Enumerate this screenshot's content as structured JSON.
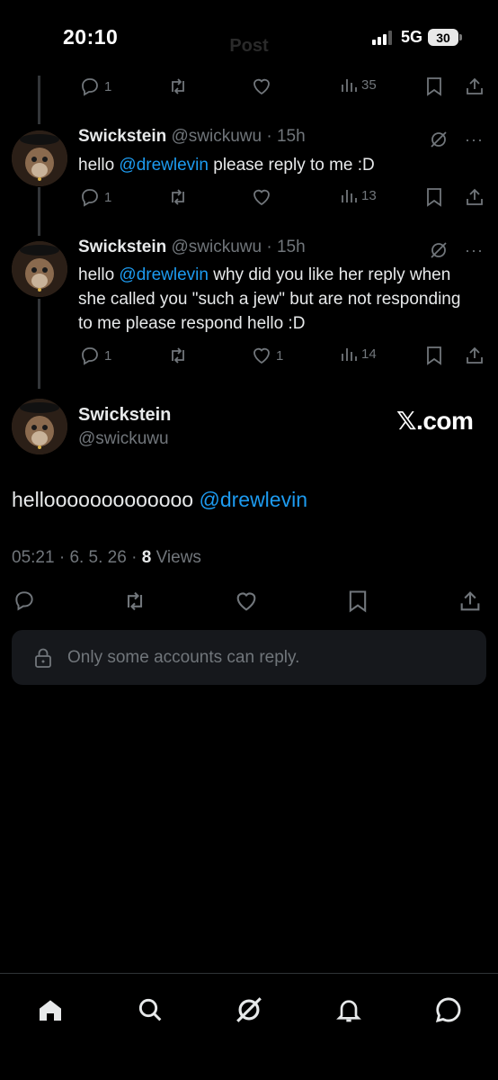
{
  "status_bar": {
    "time": "20:10",
    "network": "5G",
    "battery": "30",
    "faded_title": "Post"
  },
  "previous_post_actions": {
    "replies": "1",
    "views": "35"
  },
  "replies": [
    {
      "name": "Swickstein",
      "handle": "@swickuwu",
      "time": "15h",
      "text_before": "hello ",
      "mention": "@drewlevin",
      "text_after": " please reply to me :D",
      "reply_count": "1",
      "like_count": "",
      "view_count": "13"
    },
    {
      "name": "Swickstein",
      "handle": "@swickuwu",
      "time": "15h",
      "text_before": "hello ",
      "mention": "@drewlevin",
      "text_after": " why did you like her reply when she called you \"such a jew\" but are not responding to me please respond hello :D",
      "reply_count": "1",
      "like_count": "1",
      "view_count": "14"
    }
  ],
  "main_post": {
    "name": "Swickstein",
    "handle": "@swickuwu",
    "brand": "𝕏.com",
    "text": "hellooooooooooooo ",
    "mention": "@drewlevin",
    "time": "05:21",
    "date": "6. 5. 26",
    "views_count": "8",
    "views_label": "Views"
  },
  "restricted_notice": "Only some accounts can reply.",
  "icons": {
    "reply": "reply-icon",
    "repost": "repost-icon",
    "like": "like-icon",
    "views": "views-icon",
    "bookmark": "bookmark-icon",
    "share": "share-icon",
    "grok": "grok-icon",
    "lock": "lock-icon",
    "nav": [
      "home-icon",
      "search-icon",
      "grok-icon",
      "notifications-icon",
      "messages-icon"
    ]
  },
  "colors": {
    "background": "#000000",
    "text": "#e7e9ea",
    "muted": "#71767b",
    "mention": "#1d9bf0",
    "notice_bg": "#16181c"
  }
}
